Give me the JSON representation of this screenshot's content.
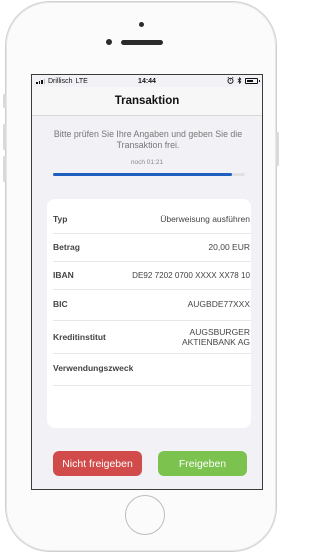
{
  "statusbar": {
    "carrier": "Drillisch",
    "network": "LTE",
    "time": "14:44"
  },
  "navbar": {
    "title": "Transaktion"
  },
  "instruction": "Bitte prüfen Sie Ihre Angaben und geben Sie die Transaktion frei.",
  "timer": "noch 01:21",
  "progress": 0.93,
  "details": {
    "typ": {
      "label": "Typ",
      "value": "Überweisung ausführen"
    },
    "betrag": {
      "label": "Betrag",
      "value": "20,00 EUR"
    },
    "iban": {
      "label": "IBAN",
      "value": "DE92 7202 0700 XXXX XX78 10"
    },
    "bic": {
      "label": "BIC",
      "value": "AUGBDE77XXX"
    },
    "kreditinstitut": {
      "label": "Kreditinstitut",
      "value_line1": "AUGSBURGER",
      "value_line2": "AKTIENBANK AG"
    },
    "verwendungszweck": {
      "label": "Verwendungszweck",
      "value": ""
    }
  },
  "buttons": {
    "reject": "Nicht freigeben",
    "accept": "Freigeben"
  },
  "colors": {
    "reject": "#d14b4b",
    "accept": "#7bc24e",
    "progress": "#1f5fbf"
  },
  "icons": [
    "signal-icon",
    "alarm-icon",
    "bluetooth-icon",
    "battery-icon"
  ]
}
